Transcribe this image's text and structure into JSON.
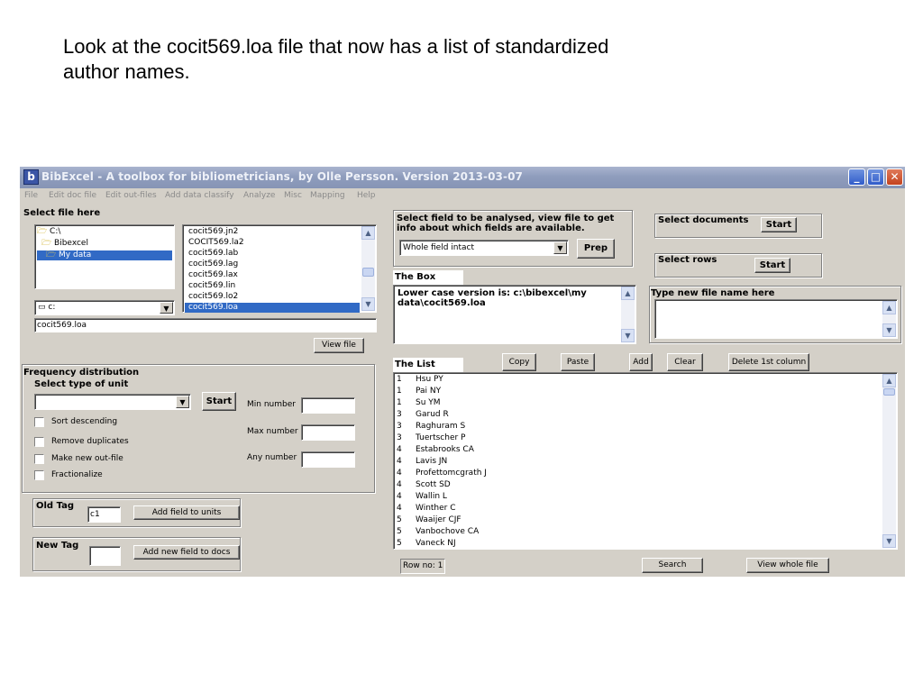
{
  "caption": "Look at the cocit569.loa file that now has a list of standardized author names.",
  "window": {
    "title": "BibExcel - A toolbox for bibliometricians, by Olle Persson. Version 2013-03-07",
    "icon": "bibexcel-app-icon",
    "controls": {
      "minimize": "_",
      "maximize": "□",
      "close": "✕"
    }
  },
  "menu": [
    "File",
    "Edit doc file",
    "Edit out-files",
    "Add data classify",
    "Analyze",
    "Misc",
    "Mapping",
    "Help"
  ],
  "file_select": {
    "label": "Select file here",
    "folders": [
      "C:\\",
      "Bibexcel",
      "My data"
    ],
    "selected_folder": "My data",
    "files": [
      "cocit569.jn2",
      "COCIT569.la2",
      "cocit569.lab",
      "cocit569.lag",
      "cocit569.lax",
      "cocit569.lin",
      "cocit569.lo2",
      "cocit569.loa"
    ],
    "selected_file": "cocit569.loa",
    "drive": "c:",
    "filename": "cocit569.loa",
    "view_file": "View file"
  },
  "frequency": {
    "label": "Frequency distribution",
    "select_type": "Select type of unit",
    "start": "Start",
    "options": [
      "Sort descending",
      "Remove duplicates",
      "Make new out-file",
      "Fractionalize"
    ],
    "min_number": "Min number",
    "max_number": "Max number",
    "any_number": "Any number"
  },
  "tags": {
    "old_tag": "Old Tag",
    "old_value": "c1",
    "add_field_units": "Add field to units",
    "new_tag": "New Tag",
    "new_value": "",
    "add_new_field": "Add new field to docs"
  },
  "field_panel": {
    "label": "Select field to be analysed, view file to get info about which fields are available.",
    "combo_value": "Whole field intact",
    "prep": "Prep"
  },
  "select_documents": {
    "label": "Select documents",
    "start": "Start"
  },
  "select_rows": {
    "label": "Select rows",
    "start": "Start"
  },
  "box": {
    "label": "The Box",
    "text": "Lower case version is: c:\\bibexcel\\my data\\cocit569.loa"
  },
  "new_file": {
    "label": "Type new file name here",
    "value": ""
  },
  "list": {
    "label": "The List",
    "buttons": {
      "copy": "Copy",
      "paste": "Paste",
      "add": "Add",
      "clear": "Clear",
      "delete_first": "Delete 1st column"
    },
    "rows": [
      [
        "1",
        "Hsu PY"
      ],
      [
        "1",
        "Pai NY"
      ],
      [
        "1",
        "Su YM"
      ],
      [
        "3",
        "Garud R"
      ],
      [
        "3",
        "Raghuram S"
      ],
      [
        "3",
        "Tuertscher P"
      ],
      [
        "4",
        "Estabrooks CA"
      ],
      [
        "4",
        "Lavis JN"
      ],
      [
        "4",
        "Profettomcgrath J"
      ],
      [
        "4",
        "Scott SD"
      ],
      [
        "4",
        "Wallin L"
      ],
      [
        "4",
        "Winther C"
      ],
      [
        "5",
        "Waaijer CJF"
      ],
      [
        "5",
        "Vanbochove CA"
      ],
      [
        "5",
        "Vaneck NJ"
      ]
    ]
  },
  "footer": {
    "row_no": "Row no: 1",
    "search": "Search",
    "view_whole": "View whole file"
  },
  "colors": {
    "titlebar": "#8f9dbd",
    "face": "#d4d0c8",
    "selection": "#316ac5"
  }
}
